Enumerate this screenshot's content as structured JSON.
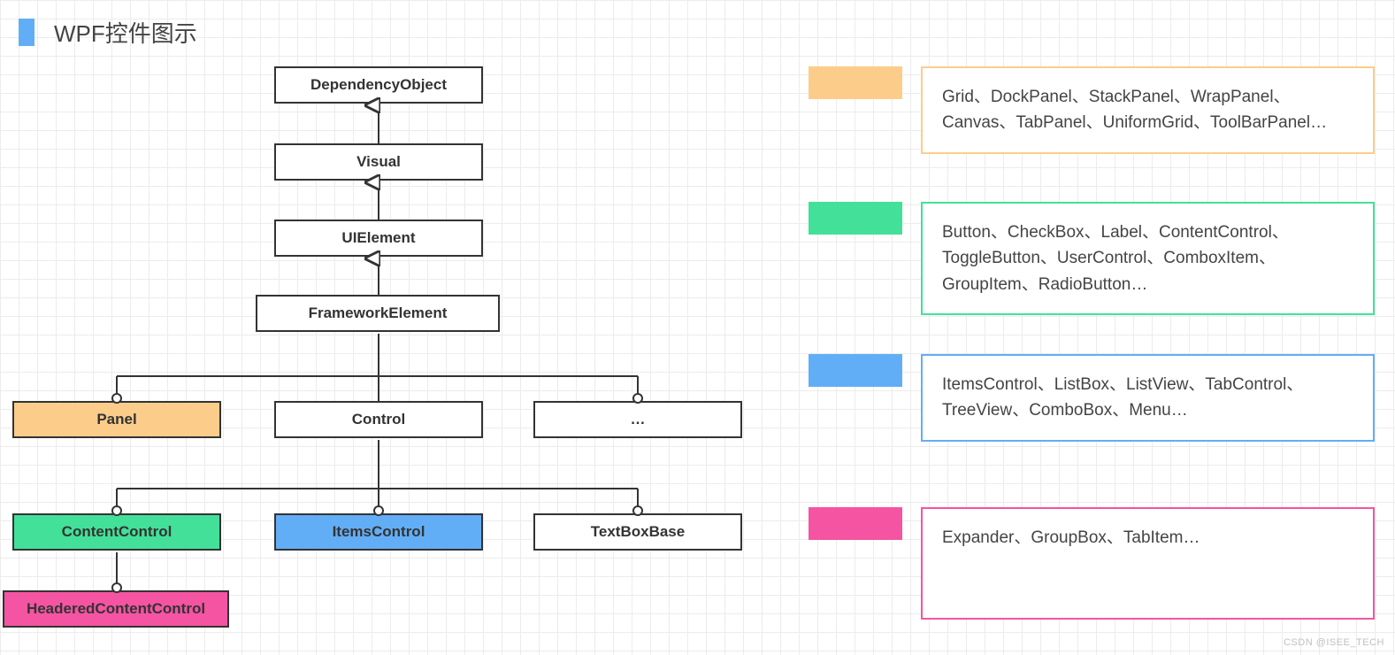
{
  "title": "WPF控件图示",
  "colors": {
    "orange": "#fccd8a",
    "green": "#43e099",
    "blue": "#62aef6",
    "pink": "#f554a2"
  },
  "nodes": {
    "dep": "DependencyObject",
    "vis": "Visual",
    "uie": "UIElement",
    "fe": "FrameworkElement",
    "panel": "Panel",
    "ctrl": "Control",
    "dots": "…",
    "cc": "ContentControl",
    "ic": "ItemsControl",
    "tbb": "TextBoxBase",
    "hcc": "HeaderedContentControl"
  },
  "legend": {
    "orange": "Grid、DockPanel、StackPanel、WrapPanel、Canvas、TabPanel、UniformGrid、ToolBarPanel…",
    "green": "Button、CheckBox、Label、ContentControl、ToggleButton、UserControl、ComboxItem、GroupItem、RadioButton…",
    "blue": "ItemsControl、ListBox、ListView、TabControl、TreeView、ComboBox、Menu…",
    "pink": "Expander、GroupBox、TabItem…"
  },
  "watermark": "CSDN @ISEE_TECH"
}
